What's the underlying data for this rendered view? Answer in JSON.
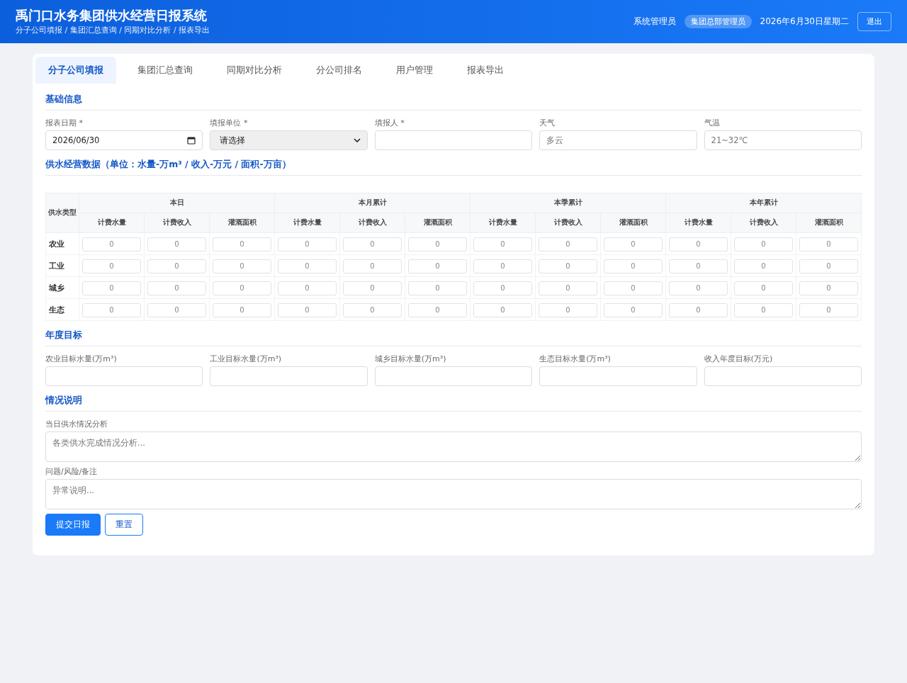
{
  "header": {
    "title": "禹门口水务集团供水经营日报系统",
    "subtitle": "分子公司填报 / 集团汇总查询 / 同期对比分析 / 报表导出",
    "user": "系统管理员",
    "role": "集团总部管理员",
    "date": "2026年6月30日星期二",
    "logout": "退出"
  },
  "tabs": [
    {
      "label": "分子公司填报",
      "selected": true
    },
    {
      "label": "集团汇总查询",
      "selected": false
    },
    {
      "label": "同期对比分析",
      "selected": false
    },
    {
      "label": "分公司排名",
      "selected": false
    },
    {
      "label": "用户管理",
      "selected": false
    },
    {
      "label": "报表导出",
      "selected": false
    }
  ],
  "basic": {
    "title": "基础信息",
    "fields": [
      {
        "kind": "date",
        "label": "报表日期 *",
        "value": "2026/06/30"
      },
      {
        "kind": "select",
        "label": "填报单位 *",
        "value": "请选择"
      },
      {
        "kind": "text",
        "label": "填报人 *"
      },
      {
        "kind": "text",
        "label": "天气",
        "placeholder": "多云"
      },
      {
        "kind": "text",
        "label": "气温",
        "placeholder": "21~32℃"
      }
    ]
  },
  "operations": {
    "title": "供水经营数据（单位：水量-万m³ / 收入-万元 / 面积-万亩）",
    "row_header": "供水类型",
    "groups": [
      {
        "label": "本日",
        "subcolumns": [
          "计费水量",
          "计费收入",
          "灌溉面积"
        ]
      },
      {
        "label": "本月累计",
        "subcolumns": [
          "计费水量",
          "计费收入",
          "灌溉面积"
        ]
      },
      {
        "label": "本季累计",
        "subcolumns": [
          "计费水量",
          "计费收入",
          "灌溉面积"
        ]
      },
      {
        "label": "本年累计",
        "subcolumns": [
          "计费水量",
          "计费收入",
          "灌溉面积"
        ]
      }
    ],
    "rows": [
      {
        "name": "农业",
        "cells": [
          {
            "placeholder": "0"
          },
          {
            "placeholder": "0"
          },
          {
            "placeholder": "0"
          },
          {
            "placeholder": "0"
          },
          {
            "placeholder": "0"
          },
          {
            "placeholder": "0"
          },
          {
            "placeholder": "0"
          },
          {
            "placeholder": "0"
          },
          {
            "placeholder": "0"
          },
          {
            "placeholder": "0"
          },
          {
            "placeholder": "0"
          },
          {
            "placeholder": "0"
          }
        ]
      },
      {
        "name": "工业",
        "cells": [
          {
            "placeholder": "0"
          },
          {
            "placeholder": "0"
          },
          {
            "placeholder": "0"
          },
          {
            "placeholder": "0"
          },
          {
            "placeholder": "0"
          },
          {
            "placeholder": "0"
          },
          {
            "placeholder": "0"
          },
          {
            "placeholder": "0"
          },
          {
            "placeholder": "0"
          },
          {
            "placeholder": "0"
          },
          {
            "placeholder": "0"
          },
          {
            "placeholder": "0"
          }
        ]
      },
      {
        "name": "城乡",
        "cells": [
          {
            "placeholder": "0"
          },
          {
            "placeholder": "0"
          },
          {
            "placeholder": "0"
          },
          {
            "placeholder": "0"
          },
          {
            "placeholder": "0"
          },
          {
            "placeholder": "0"
          },
          {
            "placeholder": "0"
          },
          {
            "placeholder": "0"
          },
          {
            "placeholder": "0"
          },
          {
            "placeholder": "0"
          },
          {
            "placeholder": "0"
          },
          {
            "placeholder": "0"
          }
        ]
      },
      {
        "name": "生态",
        "cells": [
          {
            "placeholder": "0"
          },
          {
            "placeholder": "0"
          },
          {
            "placeholder": "0"
          },
          {
            "placeholder": "0"
          },
          {
            "placeholder": "0"
          },
          {
            "placeholder": "0"
          },
          {
            "placeholder": "0"
          },
          {
            "placeholder": "0"
          },
          {
            "placeholder": "0"
          },
          {
            "placeholder": "0"
          },
          {
            "placeholder": "0"
          },
          {
            "placeholder": "0"
          }
        ]
      }
    ]
  },
  "targets": {
    "title": "年度目标",
    "fields": [
      {
        "label": "农业目标水量(万m³)"
      },
      {
        "label": "工业目标水量(万m³)"
      },
      {
        "label": "城乡目标水量(万m³)"
      },
      {
        "label": "生态目标水量(万m³)"
      },
      {
        "label": "收入年度目标(万元)"
      }
    ]
  },
  "notes": {
    "title": "情况说明",
    "fields": [
      {
        "label": "当日供水情况分析",
        "placeholder": "各类供水完成情况分析..."
      },
      {
        "label": "问题/风险/备注",
        "placeholder": "异常说明..."
      }
    ]
  },
  "buttons": [
    {
      "kind": "primary",
      "label": "提交日报"
    },
    {
      "kind": "secondary",
      "label": "重置"
    }
  ]
}
